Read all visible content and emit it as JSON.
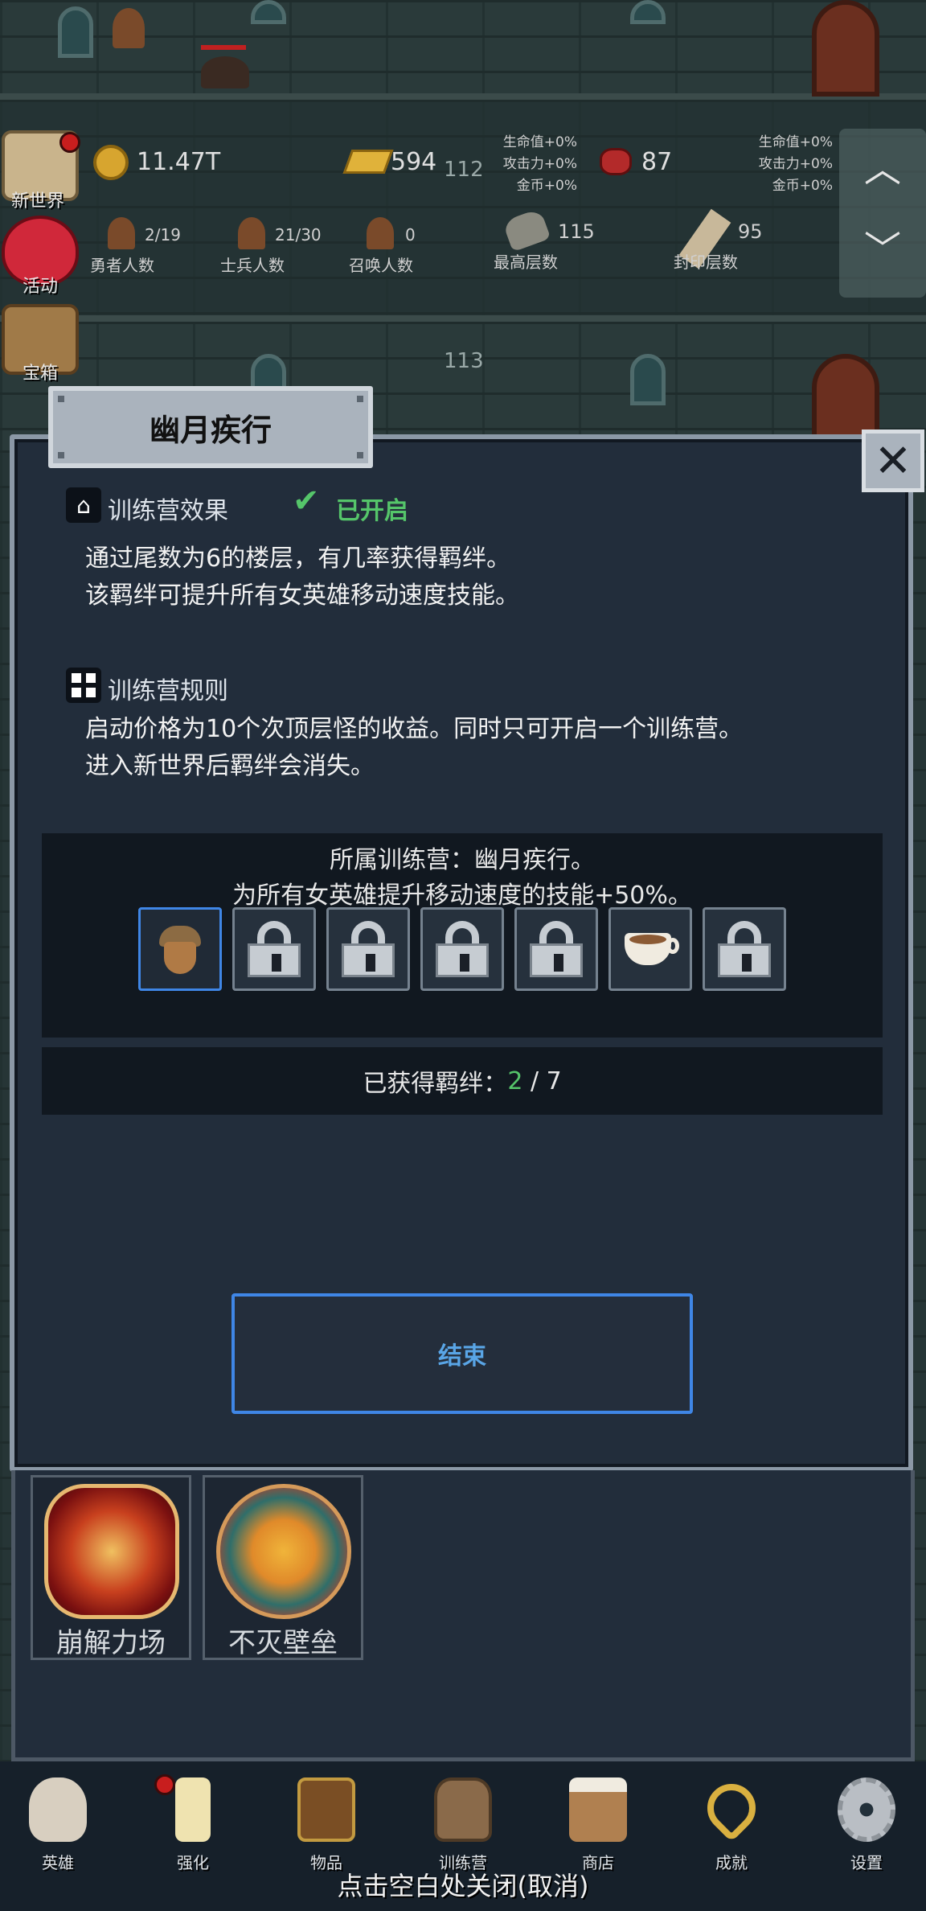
{
  "hud": {
    "gold": "11.47T",
    "bars": "594",
    "bars_floor": "112",
    "gems": "87",
    "bonus_left": [
      "生命值+0%",
      "攻击力+0%",
      "金币+0%"
    ],
    "bonus_right": [
      "生命值+0%",
      "攻击力+0%",
      "金币+0%"
    ],
    "hero_count": "2/19",
    "hero_label": "勇者人数",
    "soldier_count": "21/30",
    "soldier_label": "士兵人数",
    "summon_count": "0",
    "summon_label": "召唤人数",
    "top_floor": "115",
    "top_floor_label": "最高层数",
    "seal_floor": "95",
    "seal_floor_label": "封印层数",
    "floor_113": "113"
  },
  "side_menu": {
    "new_world": "新世界",
    "event": "活动",
    "chest": "宝箱"
  },
  "dialog": {
    "title": "幽月疾行",
    "effect_heading": "训练营效果",
    "status": "已开启",
    "effect_lines": [
      "通过尾数为6的楼层，有几率获得羁绊。",
      "该羁绊可提升所有女英雄移动速度技能。"
    ],
    "rules_heading": "训练营规则",
    "rules_lines": [
      "启动价格为10个次顶层怪的收益。同时只可开启一个训练营。",
      "进入新世界后羁绊会消失。"
    ],
    "camp_line": "所属训练营：幽月疾行。",
    "bonus_line": "为所有女英雄提升移动速度的技能+50%。",
    "slots": [
      "acorn-icon",
      "lock-icon",
      "lock-icon",
      "lock-icon",
      "lock-icon",
      "coffee-icon",
      "lock-icon"
    ],
    "obtained_label": "已获得羁绊：",
    "obtained_current": "2",
    "obtained_sep": " / ",
    "obtained_total": "7",
    "end_button": "结束"
  },
  "skills": [
    {
      "label": "崩解力场",
      "icon": "collapse-field-icon"
    },
    {
      "label": "不灭壁垒",
      "icon": "immortal-barrier-icon"
    }
  ],
  "nav": [
    {
      "label": "英雄",
      "icon": "skull-icon"
    },
    {
      "label": "强化",
      "icon": "candle-icon"
    },
    {
      "label": "物品",
      "icon": "book-icon"
    },
    {
      "label": "训练营",
      "icon": "lantern-icon"
    },
    {
      "label": "商店",
      "icon": "mug-icon"
    },
    {
      "label": "成就",
      "icon": "key-icon"
    },
    {
      "label": "设置",
      "icon": "gear-icon"
    }
  ],
  "close_hint": "点击空白处关闭(取消)",
  "colors": {
    "accent_blue": "#3f86e6",
    "active_green": "#55c56a",
    "dialog_bg": "#222d3b"
  }
}
